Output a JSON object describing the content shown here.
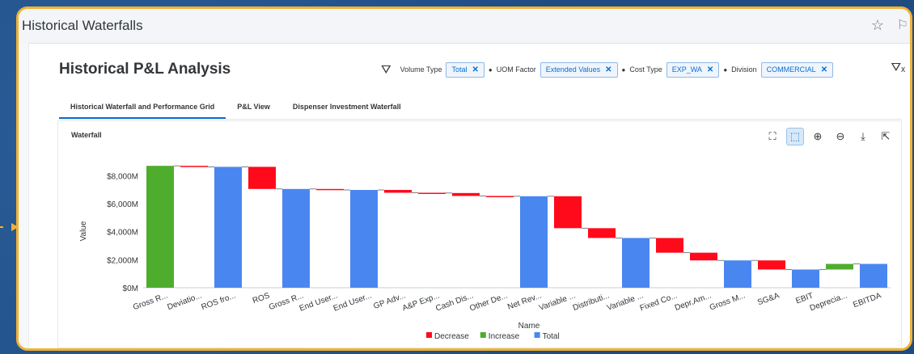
{
  "window": {
    "title": "Historical Waterfalls"
  },
  "page": {
    "title": "Historical P&L Analysis"
  },
  "filters": [
    {
      "label": "Volume Type",
      "value": "Total"
    },
    {
      "label": "UOM Factor",
      "value": "Extended Values"
    },
    {
      "label": "Cost Type",
      "value": "EXP_WA"
    },
    {
      "label": "Division",
      "value": "COMMERCIAL"
    }
  ],
  "tabs": [
    {
      "label": "Historical Waterfall and Performance Grid",
      "active": true
    },
    {
      "label": "P&L View",
      "active": false
    },
    {
      "label": "Dispenser Investment Waterfall",
      "active": false
    }
  ],
  "card": {
    "title": "Waterfall"
  },
  "toolbar_icons": [
    "zoom-fit-icon",
    "select-zoom-icon",
    "zoom-in-icon",
    "zoom-out-icon",
    "download-icon",
    "fullscreen-icon"
  ],
  "colors": {
    "decrease": "#ff0a1b",
    "increase": "#4fad2e",
    "total": "#4a86f0",
    "accent": "#0a6ed1",
    "frame": "#f0b234"
  },
  "chart_data": {
    "type": "waterfall",
    "xlabel": "Name",
    "ylabel": "Value",
    "ylim": [
      0,
      9000
    ],
    "yticks": [
      "$0M",
      "$2,000M",
      "$4,000M",
      "$6,000M",
      "$8,000M"
    ],
    "legend": [
      "Decrease",
      "Increase",
      "Total"
    ],
    "bars": [
      {
        "label": "Gross R...",
        "kind": "increase",
        "start": 0,
        "end": 8700
      },
      {
        "label": "Deviatio...",
        "kind": "decrease",
        "start": 8700,
        "end": 8630
      },
      {
        "label": "ROS fro...",
        "kind": "total",
        "start": 0,
        "end": 8630
      },
      {
        "label": "ROS",
        "kind": "decrease",
        "start": 8630,
        "end": 7050
      },
      {
        "label": "Gross R...",
        "kind": "total",
        "start": 0,
        "end": 7050
      },
      {
        "label": "End User...",
        "kind": "decrease",
        "start": 7050,
        "end": 6980
      },
      {
        "label": "End User...",
        "kind": "total",
        "start": 0,
        "end": 6980
      },
      {
        "label": "GP Adv...",
        "kind": "decrease",
        "start": 6980,
        "end": 6780
      },
      {
        "label": "A&P Exp...",
        "kind": "decrease",
        "start": 6780,
        "end": 6760
      },
      {
        "label": "Cash Dis...",
        "kind": "decrease",
        "start": 6760,
        "end": 6550
      },
      {
        "label": "Other De...",
        "kind": "decrease",
        "start": 6550,
        "end": 6530
      },
      {
        "label": "Net Rev...",
        "kind": "total",
        "start": 0,
        "end": 6530
      },
      {
        "label": "Variable ...",
        "kind": "decrease",
        "start": 6530,
        "end": 4250
      },
      {
        "label": "Distributi...",
        "kind": "decrease",
        "start": 4250,
        "end": 3550
      },
      {
        "label": "Variable ...",
        "kind": "total",
        "start": 0,
        "end": 3550
      },
      {
        "label": "Fixed Co...",
        "kind": "decrease",
        "start": 3550,
        "end": 2500
      },
      {
        "label": "Depr,Am...",
        "kind": "decrease",
        "start": 2500,
        "end": 1950
      },
      {
        "label": "Gross M...",
        "kind": "total",
        "start": 0,
        "end": 1950
      },
      {
        "label": "SG&A",
        "kind": "decrease",
        "start": 1950,
        "end": 1300
      },
      {
        "label": "EBIT",
        "kind": "total",
        "start": 0,
        "end": 1300
      },
      {
        "label": "Deprecia...",
        "kind": "increase",
        "start": 1300,
        "end": 1700
      },
      {
        "label": "EBITDA",
        "kind": "total",
        "start": 0,
        "end": 1700
      }
    ]
  }
}
